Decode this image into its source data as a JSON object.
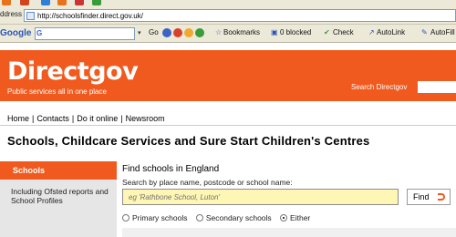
{
  "browser": {
    "address_label": "ddress",
    "url": "http://schoolsfinder.direct.gov.uk/",
    "toolbar": {
      "logo": "Google",
      "search_glyph": "G",
      "items": [
        "Go",
        "Bookmarks",
        "0 blocked",
        "Check",
        "AutoLink",
        "AutoFill"
      ],
      "icon_colors": [
        "#3b62c4",
        "#d7402b",
        "#f0a92e",
        "#3a9b3a"
      ]
    },
    "top_icon_colors": [
      "#e8731a",
      "#d0441f",
      "#2f7ed8",
      "#e8731a",
      "#c33",
      "#3a9b3a"
    ]
  },
  "header": {
    "logo": "Directgov",
    "strapline": "Public services all in one place",
    "search_label": "Search Directgov",
    "brand_color": "#f05a1e"
  },
  "nav": {
    "items": [
      "Home",
      "Contacts",
      "Do it online",
      "Newsroom"
    ]
  },
  "page": {
    "title": "Schools, Childcare Services and Sure Start Children's Centres"
  },
  "sidebar": {
    "active_tab": "Schools",
    "description": "Including Ofsted reports and School Profiles"
  },
  "find": {
    "title": "Find schools in England",
    "hint": "Search by place name, postcode or school name:",
    "placeholder": "eg 'Rathbone School, Luton'",
    "button_label": "Find",
    "radio_options": [
      {
        "label": "Primary schools",
        "selected": false
      },
      {
        "label": "Secondary schools",
        "selected": false
      },
      {
        "label": "Either",
        "selected": true
      }
    ]
  }
}
